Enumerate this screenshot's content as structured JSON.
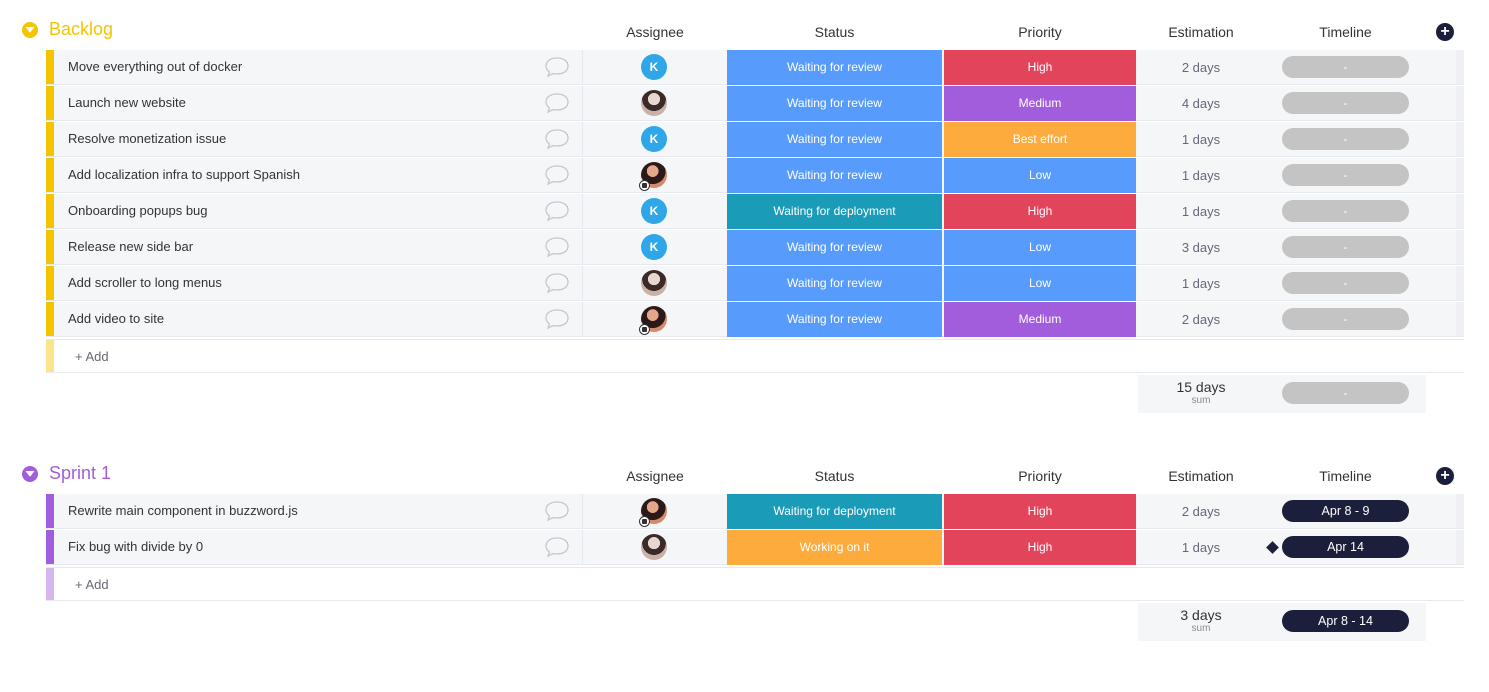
{
  "colors": {
    "backlog": "#f5c400",
    "sprint": "#a25ddc",
    "waiting_review": "#579bfc",
    "waiting_deploy": "#1a9bb8",
    "working": "#fdab3d",
    "high": "#e2445c",
    "medium": "#a25ddc",
    "low": "#579bfc",
    "best_effort": "#fdab3d"
  },
  "columns": {
    "assignee": "Assignee",
    "status": "Status",
    "priority": "Priority",
    "estimation": "Estimation",
    "timeline": "Timeline"
  },
  "groups": [
    {
      "title": "Backlog",
      "add_label": "+ Add",
      "rows": [
        {
          "name": "Move everything out of docker",
          "assignee": "K",
          "status": "Waiting for review",
          "priority": "High",
          "estimation": "2 days",
          "timeline": "-"
        },
        {
          "name": "Launch new website",
          "assignee": "photo",
          "status": "Waiting for review",
          "priority": "Medium",
          "estimation": "4 days",
          "timeline": "-"
        },
        {
          "name": "Resolve monetization issue",
          "assignee": "K",
          "status": "Waiting for review",
          "priority": "Best effort",
          "estimation": "1 days",
          "timeline": "-"
        },
        {
          "name": "Add localization infra to support Spanish",
          "assignee": "photo2",
          "status": "Waiting for review",
          "priority": "Low",
          "estimation": "1 days",
          "timeline": "-"
        },
        {
          "name": "Onboarding popups bug",
          "assignee": "K",
          "status": "Waiting for deployment",
          "priority": "High",
          "estimation": "1 days",
          "timeline": "-"
        },
        {
          "name": "Release new side bar",
          "assignee": "K",
          "status": "Waiting for review",
          "priority": "Low",
          "estimation": "3 days",
          "timeline": "-"
        },
        {
          "name": "Add scroller to long menus",
          "assignee": "photo",
          "status": "Waiting for review",
          "priority": "Low",
          "estimation": "1 days",
          "timeline": "-"
        },
        {
          "name": "Add video to site",
          "assignee": "photo2",
          "status": "Waiting for review",
          "priority": "Medium",
          "estimation": "2 days",
          "timeline": "-"
        }
      ],
      "summary": {
        "value": "15 days",
        "label": "sum",
        "timeline": "-"
      }
    },
    {
      "title": "Sprint 1",
      "add_label": "+ Add",
      "rows": [
        {
          "name": "Rewrite main component in buzzword.js",
          "assignee": "photo2",
          "status": "Waiting for deployment",
          "priority": "High",
          "estimation": "2 days",
          "timeline": "Apr 8 - 9"
        },
        {
          "name": "Fix bug with divide by 0",
          "assignee": "photo",
          "status": "Working on it",
          "priority": "High",
          "estimation": "1 days",
          "timeline": "Apr 14"
        }
      ],
      "summary": {
        "value": "3 days",
        "label": "sum",
        "timeline": "Apr 8 - 14"
      }
    }
  ]
}
